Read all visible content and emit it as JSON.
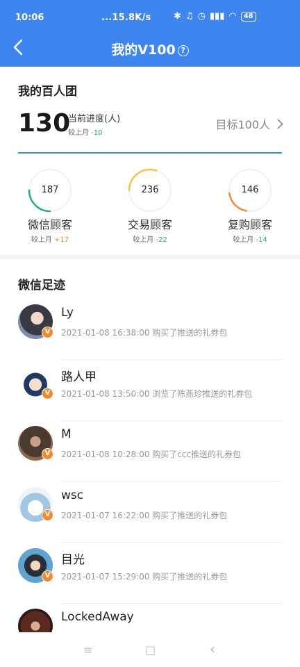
{
  "status_bar": {
    "time": "10:06",
    "network": "...15.8K/s",
    "battery": "48"
  },
  "header": {
    "title": "我的V100",
    "help_glyph": "?",
    "back_icon": "chevron-left-icon"
  },
  "group": {
    "title": "我的百人团",
    "count": "130",
    "progress_label": "当前进度(人)",
    "compare_label": "较上月",
    "compare_delta": "-10",
    "target_text": "目标100人"
  },
  "stats": [
    {
      "value": "187",
      "label": "微信顾客",
      "compare_label": "较上月",
      "delta": "+17",
      "ring_color": "#20b070",
      "ring_fraction": 0.25
    },
    {
      "value": "236",
      "label": "交易顾客",
      "compare_label": "较上月",
      "delta": "-22",
      "ring_color": "#f5c542",
      "ring_fraction": 0.3
    },
    {
      "value": "146",
      "label": "复购顾客",
      "compare_label": "较上月",
      "delta": "-14",
      "ring_color": "#f08a2c",
      "ring_fraction": 0.2
    }
  ],
  "feed": {
    "title": "微信足迹",
    "badge": "V",
    "items": [
      {
        "name": "Ly",
        "desc": "2021-01-08 16:38:00 购买了推送的礼券包"
      },
      {
        "name": "路人甲",
        "desc": "2021-01-08 13:50:00 浏览了陈燕珍推送的礼券包"
      },
      {
        "name": "M",
        "desc": "2021-01-08 10:28:00 购买了ccc推送的礼券包"
      },
      {
        "name": "wsc",
        "desc": "2021-01-07 16:22:00 购买了推送的礼券包"
      },
      {
        "name": "目光",
        "desc": "2021-01-07 15:29:00 购买了推送的礼券包"
      },
      {
        "name": "LockedAway",
        "desc": ""
      }
    ]
  },
  "nav": {
    "menu_glyph": "≡",
    "home_glyph": "□",
    "back_glyph": "‹"
  }
}
